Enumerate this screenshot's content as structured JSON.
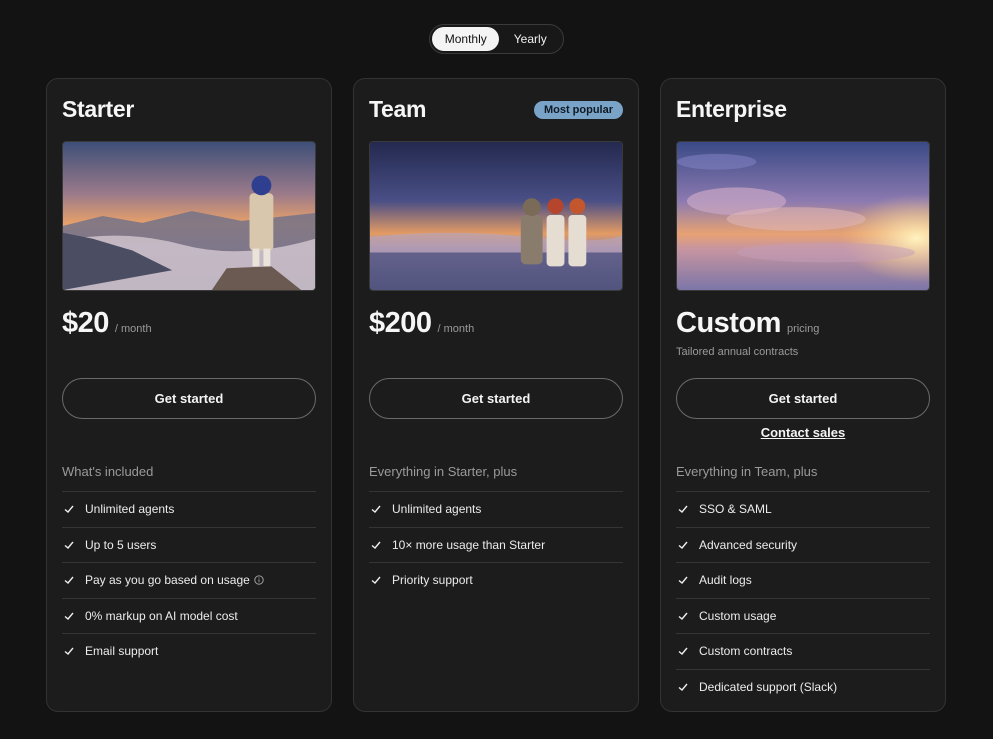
{
  "billing_toggle": {
    "monthly": "Monthly",
    "yearly": "Yearly",
    "selected": "Monthly"
  },
  "plans": [
    {
      "title": "Starter",
      "badge": "",
      "image": "character-on-mountain-sunset",
      "price": "$20",
      "period": "/ month",
      "note": "",
      "cta": "Get started",
      "secondary_link": "",
      "features_heading": "What's included",
      "features": [
        "Unlimited agents",
        "Up to 5 users",
        "Pay as you go based on usage",
        "0% markup on AI model cost",
        "Email support"
      ]
    },
    {
      "title": "Team",
      "badge": "Most popular",
      "image": "three-characters-above-clouds",
      "price": "$200",
      "period": "/ month",
      "note": "",
      "cta": "Get started",
      "secondary_link": "",
      "features_heading": "Everything in Starter, plus",
      "features": [
        "Unlimited agents",
        "10× more usage than Starter",
        "Priority support"
      ]
    },
    {
      "title": "Enterprise",
      "badge": "",
      "image": "sunset-cloudscape",
      "price": "Custom",
      "period": "pricing",
      "note": "Tailored annual contracts",
      "cta": "Get started",
      "secondary_link": "Contact sales",
      "features_heading": "Everything in Team, plus",
      "features": [
        "SSO & SAML",
        "Advanced security",
        "Audit logs",
        "Custom usage",
        "Custom contracts",
        "Dedicated support (Slack)"
      ]
    }
  ],
  "colors": {
    "background": "#131313",
    "card": "#1c1c1c",
    "badge": "#7aa3c8",
    "muted_text": "#9a9a9a"
  },
  "icons": {
    "feature_bullet": "check-icon",
    "usage_info": "info-icon"
  }
}
